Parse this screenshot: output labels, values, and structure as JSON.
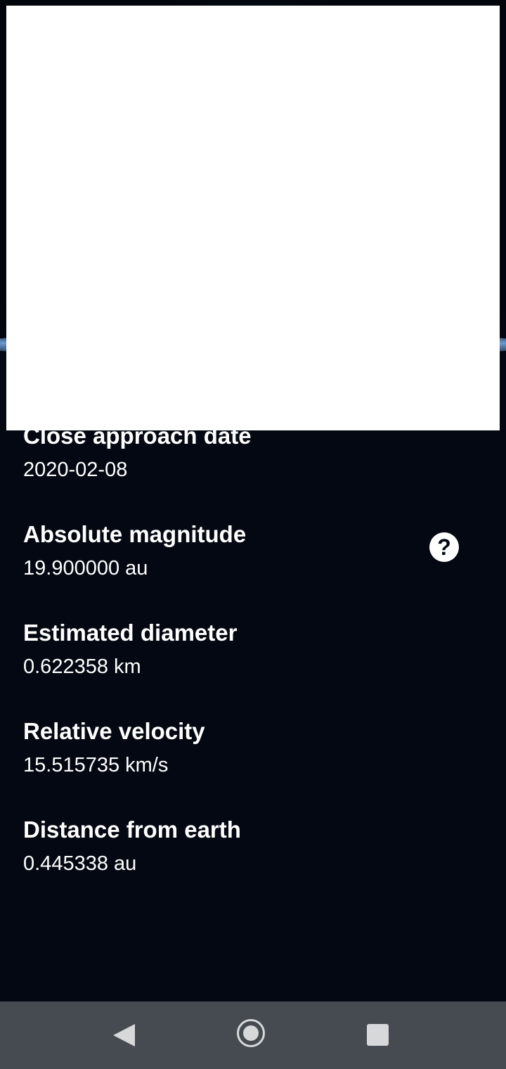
{
  "details": {
    "fields": [
      {
        "label": "Close approach date",
        "value": "2020-02-08"
      },
      {
        "label": "Absolute magnitude",
        "value": "19.900000 au"
      },
      {
        "label": "Estimated diameter",
        "value": "0.622358 km"
      },
      {
        "label": "Relative velocity",
        "value": "15.515735 km/s"
      },
      {
        "label": "Distance from earth",
        "value": "0.445338 au"
      }
    ],
    "help_glyph": "?"
  },
  "icons": {
    "help": "question-circle-icon",
    "back": "back-triangle-icon",
    "home": "home-circle-icon",
    "recents": "recents-square-icon"
  },
  "colors": {
    "background": "#030812",
    "text": "#ffffff",
    "nav_bar": "#454b51",
    "nav_icon": "#d6d8da"
  }
}
